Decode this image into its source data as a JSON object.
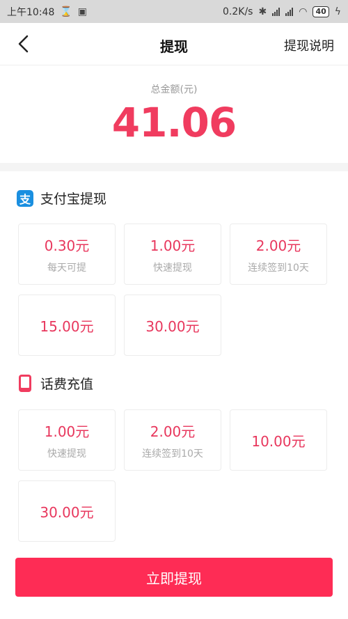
{
  "status_bar": {
    "time": "上午10:48",
    "net_speed": "0.2K/s",
    "battery": "40"
  },
  "header": {
    "title": "提现",
    "help_link": "提现说明"
  },
  "balance": {
    "label": "总金额(元)",
    "amount": "41.06"
  },
  "alipay_section": {
    "title": "支付宝提现",
    "icon_text": "支",
    "options": [
      {
        "amount": "0.30元",
        "note": "每天可提"
      },
      {
        "amount": "1.00元",
        "note": "快速提现"
      },
      {
        "amount": "2.00元",
        "note": "连续签到10天"
      },
      {
        "amount": "15.00元",
        "note": ""
      },
      {
        "amount": "30.00元",
        "note": ""
      }
    ]
  },
  "phone_section": {
    "title": "话费充值",
    "options": [
      {
        "amount": "1.00元",
        "note": "快速提现"
      },
      {
        "amount": "2.00元",
        "note": "连续签到10天"
      },
      {
        "amount": "10.00元",
        "note": ""
      },
      {
        "amount": "30.00元",
        "note": ""
      }
    ]
  },
  "action": {
    "withdraw_label": "立即提现"
  },
  "colors": {
    "accent": "#fe2c55",
    "amount_text": "#e8375d",
    "alipay_blue": "#1a8fe0"
  }
}
